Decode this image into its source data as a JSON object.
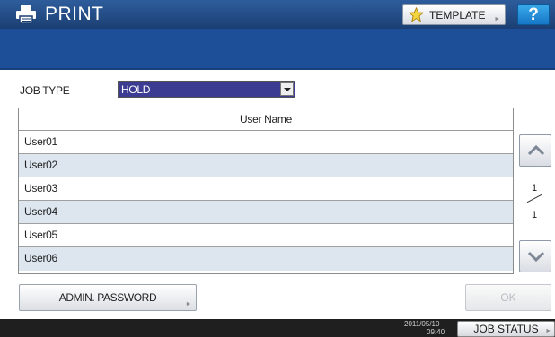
{
  "titlebar": {
    "title": "PRINT",
    "template_label": "TEMPLATE",
    "help_label": "?"
  },
  "job_type": {
    "label": "JOB TYPE",
    "selected": "HOLD"
  },
  "user_table": {
    "header": "User Name",
    "rows": [
      "User01",
      "User02",
      "User03",
      "User04",
      "User05",
      "User06"
    ]
  },
  "pagination": {
    "current": "1",
    "total": "1"
  },
  "buttons": {
    "admin_password": "ADMIN. PASSWORD",
    "ok": "OK",
    "job_status": "JOB STATUS"
  },
  "status": {
    "date": "2011/05/10",
    "time": "09:40"
  },
  "colors": {
    "title_bar": "#1b3f73",
    "header_band": "#1d4f98",
    "selected_field": "#3c3c92",
    "row_alternate": "#dde5ef",
    "help_button": "#1577c7"
  },
  "icons": [
    "printer-icon",
    "star-icon",
    "chevron-up-icon",
    "chevron-down-icon",
    "dropdown-arrow-icon"
  ]
}
